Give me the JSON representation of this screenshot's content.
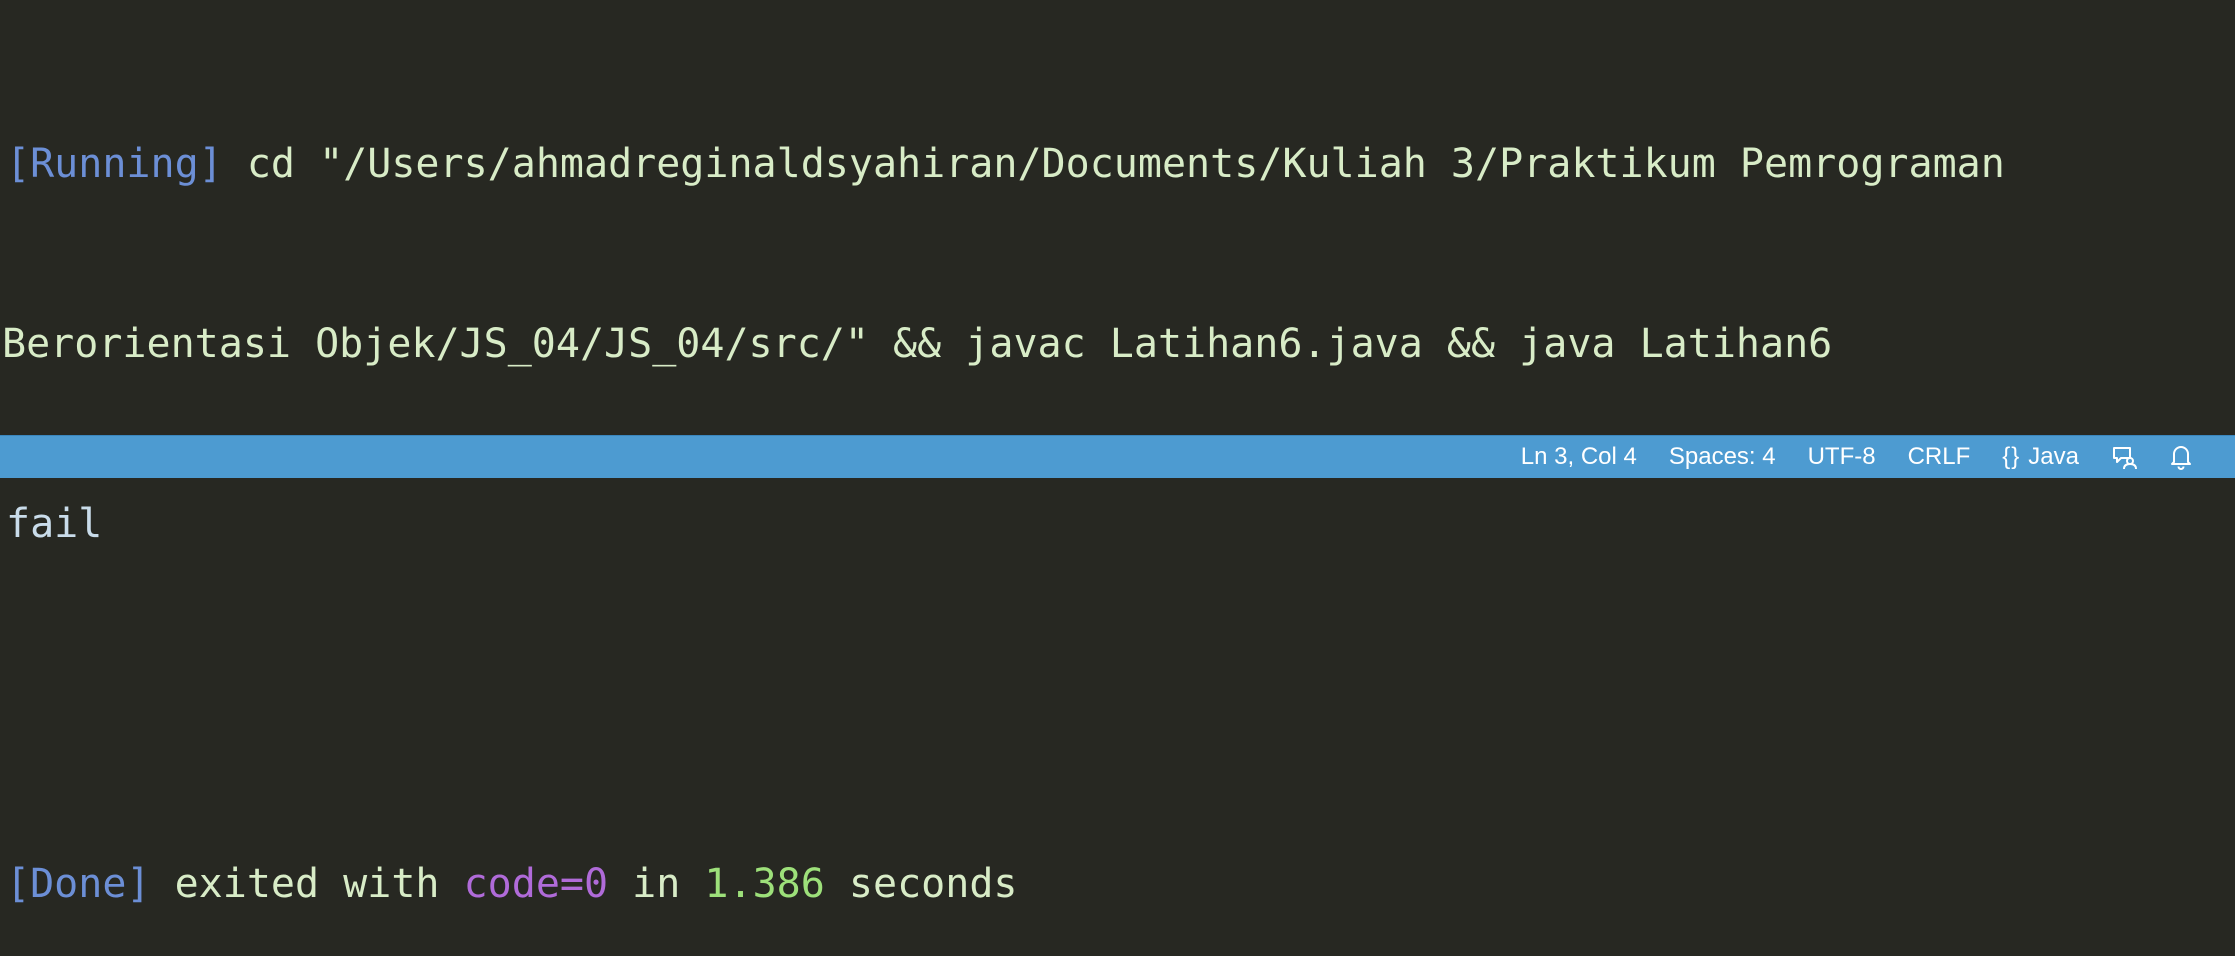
{
  "output": {
    "line1": {
      "tag": "[Running]",
      "command": " cd \"/Users/ahmadreginaldsyahiran/Documents/Kuliah 3/Praktikum Pemrograman"
    },
    "line2": {
      "command": "Berorientasi Objek/JS_04/JS_04/src/\" && javac Latihan6.java && java Latihan6"
    },
    "line3": {
      "stdout": "fail"
    },
    "line5": {
      "tag": "[Done]",
      "text1": " exited with ",
      "code": "code=0",
      "text2": " in ",
      "seconds": "1.386",
      "text3": " seconds"
    }
  },
  "statusbar": {
    "cursor_position": "Ln 3, Col 4",
    "indentation": "Spaces: 4",
    "encoding": "UTF-8",
    "line_ending": "CRLF",
    "language_icon": "{}",
    "language": "Java",
    "feedback_icon": "feedback-person-icon",
    "notifications_icon": "bell-icon"
  },
  "colors": {
    "background": "#272822",
    "tag": "#6c8fd6",
    "text": "#d8ecc7",
    "code": "#b06bd9",
    "number": "#9de07a",
    "statusbar": "#4d9bd1"
  }
}
